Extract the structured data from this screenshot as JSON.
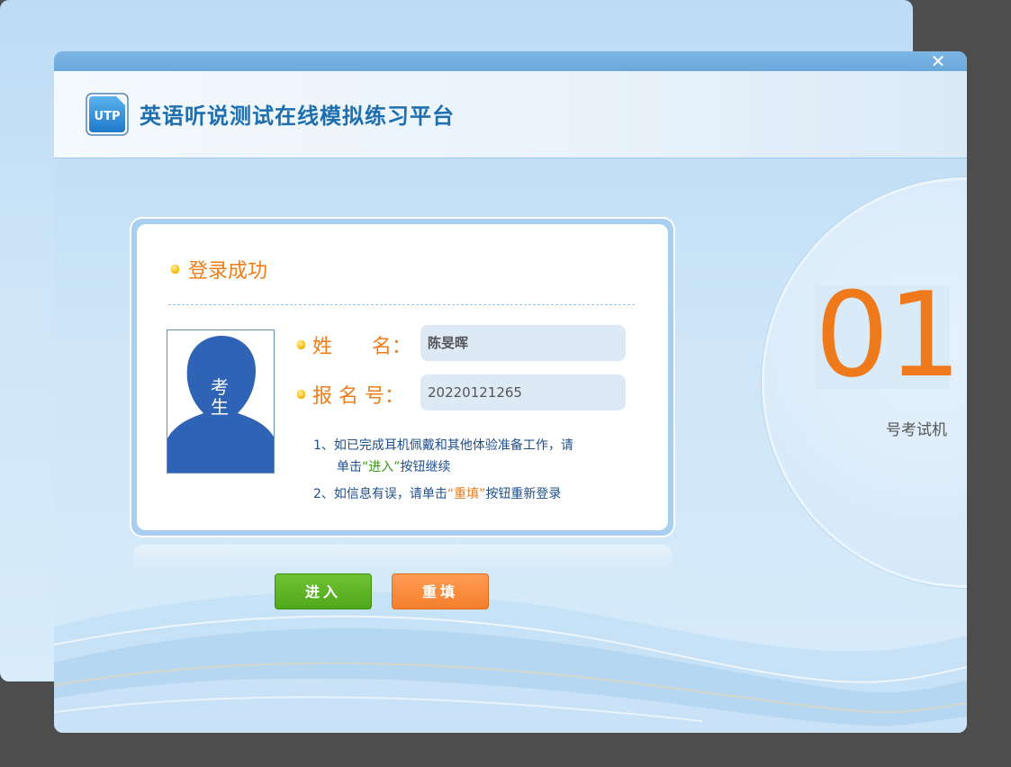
{
  "window": {
    "close_symbol": "✕"
  },
  "header": {
    "logo_text": "UTP",
    "title": "英语听说测试在线模拟练习平台"
  },
  "login": {
    "status_text": "登录成功",
    "photo_caption": "考生",
    "name_label": "姓　　名：",
    "name_value": "陈旻晖",
    "reg_label": "报 名 号：",
    "reg_value": "20220121265",
    "instructions": {
      "line1_a": "1、如已完成耳机佩戴和其他体验准备工作，请",
      "line1_b": "单击",
      "line1_hl": "“进入”",
      "line1_c": "按钮继续",
      "line2_a": "2、如信息有误，请单击",
      "line2_hl": "“重填”",
      "line2_b": "按钮重新登录"
    }
  },
  "buttons": {
    "enter_label": "进入",
    "reset_label": "重填"
  },
  "machine": {
    "number": "01",
    "label": "号考试机"
  },
  "colors": {
    "accent_orange": "#f07d1a",
    "title_blue": "#1e6fb0",
    "enter_green": "#4fa81a",
    "reset_orange": "#f47f2c"
  },
  "icons": {
    "close": "close-icon",
    "logo": "utp-logo-icon",
    "bullet": "bullet-dot-icon",
    "photo": "student-silhouette-icon"
  }
}
